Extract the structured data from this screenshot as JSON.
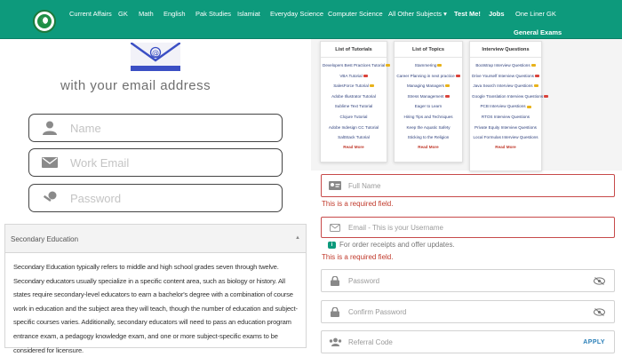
{
  "nav": {
    "logo_text": "",
    "items": [
      "Current Affairs",
      "GK",
      "Math",
      "English",
      "Pak Studies",
      "Islamiat",
      "Everyday Science",
      "Computer Science",
      "All Other Subjects ▾",
      "Test Me!",
      "Jobs",
      "One Liner GK"
    ],
    "second_row": "General Exams"
  },
  "left": {
    "email_caption": "with your email address",
    "fields": [
      {
        "placeholder": "Name",
        "icon": "user-icon"
      },
      {
        "placeholder": "Work Email",
        "icon": "mail-icon"
      },
      {
        "placeholder": "Password",
        "icon": "key-icon"
      }
    ],
    "accordion": {
      "title": "Secondary Education",
      "arrow": "▲",
      "body": "Secondary Education typically refers to middle and high school grades seven through twelve. Secondary educators usually specialize in a specific content area, such as biology or history. All states require secondary-level educators to earn a bachelor's degree with a combination of course work in education and the subject area they will teach, though the number of education and subject-specific courses varies. Additionally, secondary educators will need to pass an education program entrance exam, a pedagogy knowledge exam, and one or more subject-specific exams to be considered for licensure."
    }
  },
  "tutorials": [
    {
      "title": "List of Tutorials",
      "items": [
        "Developers Best Practices Tutorial",
        "VBA Tutorial",
        "SalesForce Tutorial",
        "Adobe Illustrator Tutorial",
        "Sublime Text Tutorial",
        "Clojure Tutorial",
        "Adobe Indesign CC Tutorial",
        "SaltStack Tutorial"
      ],
      "badges": [
        true,
        true,
        true,
        false,
        false,
        false,
        false,
        false
      ],
      "more": "Read More"
    },
    {
      "title": "List of Topics",
      "items": [
        "Stammering",
        "Career Planning in next practice",
        "Managing Managers",
        "Stress Management",
        "Eager to Learn",
        "Hiring Tips and Techniques",
        "Keep the Aquatic Safety",
        "Sticking to the Religion"
      ],
      "badges": [
        true,
        true,
        true,
        true,
        false,
        false,
        false,
        false
      ],
      "more": "Read More"
    },
    {
      "title": "Interview Questions",
      "items": [
        "Bootstrap Interview Questions",
        "Drive Yourself Interview Questions",
        "Java Search Interview Questions",
        "Google Translation Interview Questions",
        "PCB Interview Questions",
        "RTOS Interview Questions",
        "Private Equity Interview Questions",
        "Local Formulas Interview Questions"
      ],
      "badges": [
        true,
        true,
        true,
        true,
        true,
        false,
        false,
        false
      ],
      "more": "Read More"
    }
  ],
  "right_form": {
    "full_name_placeholder": "Full Name",
    "required_1": "This is a required field.",
    "email_placeholder": "Email - This is your Username",
    "info_text": "For order receipts and offer updates.",
    "required_2": "This is a required field.",
    "password_placeholder": "Password",
    "confirm_placeholder": "Confirm Password",
    "referral_placeholder": "Referral Code",
    "apply_label": "APPLY"
  },
  "colors": {
    "nav_bg": "#0d9a7c",
    "error": "#c0392b",
    "link": "#2d3f7b"
  }
}
